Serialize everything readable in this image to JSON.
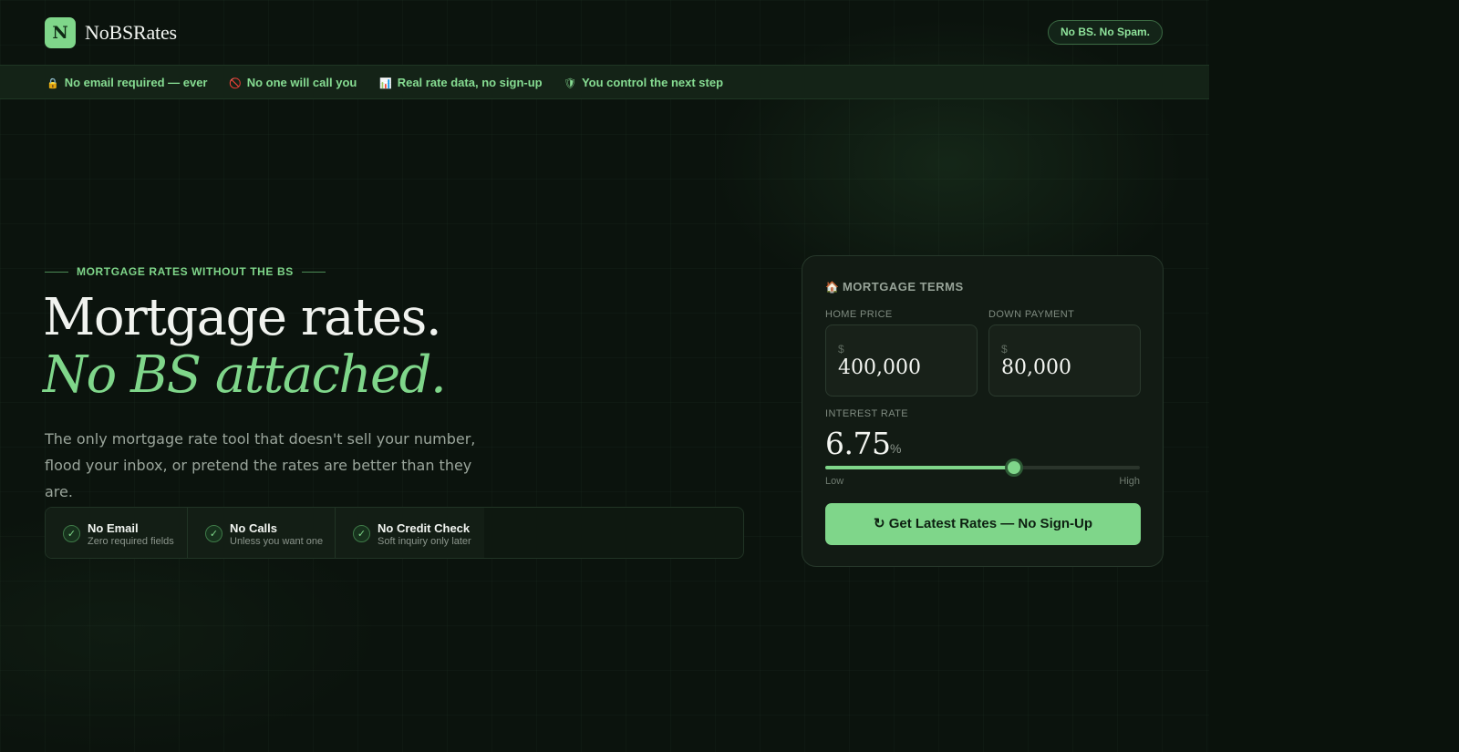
{
  "brand": {
    "logo_letter": "N",
    "name": "NoBSRates"
  },
  "header": {
    "badge": "No BS. No Spam."
  },
  "trust_bar": [
    {
      "icon": "lock-icon",
      "glyph": "🔒",
      "label": "No email required — ever"
    },
    {
      "icon": "no-entry-icon",
      "glyph": "🚫",
      "label": "No one will call you"
    },
    {
      "icon": "bar-chart-icon",
      "glyph": "📊",
      "label": "Real rate data, no sign-up"
    },
    {
      "icon": "shield-icon",
      "glyph": "🛡",
      "label": "You control the next step"
    }
  ],
  "hero": {
    "eyebrow": "MORTGAGE RATES WITHOUT THE BS",
    "title_line1": "Mortgage rates.",
    "title_line2": "No BS attached.",
    "lede": "The only mortgage rate tool that doesn't sell your number, flood your inbox, or pretend the rates are better than they are."
  },
  "features": [
    {
      "title": "No Email",
      "sub": "Zero required fields"
    },
    {
      "title": "No Calls",
      "sub": "Unless you want one"
    },
    {
      "title": "No Credit Check",
      "sub": "Soft inquiry only later"
    }
  ],
  "card": {
    "icon": "house-icon",
    "icon_glyph": "🏠",
    "title": "MORTGAGE TERMS",
    "home_price": {
      "label": "HOME PRICE",
      "currency": "$",
      "value": "400,000"
    },
    "down_payment": {
      "label": "DOWN PAYMENT",
      "currency": "$",
      "value": "80,000"
    },
    "interest_rate": {
      "label": "INTEREST RATE",
      "value": "6.75",
      "unit": "%",
      "slider_level": 0.6,
      "low_label": "Low",
      "high_label": "High"
    },
    "cta": {
      "glyph": "↻",
      "label": "Get Latest Rates — No Sign-Up"
    }
  },
  "colors": {
    "background": "#0b130d",
    "accent": "#7fd68a",
    "card": "#121b14"
  }
}
